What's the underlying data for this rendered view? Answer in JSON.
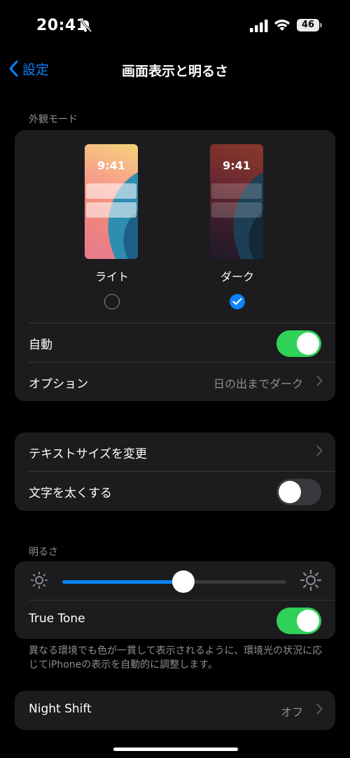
{
  "status_bar": {
    "time": "20:41",
    "battery": "46"
  },
  "nav": {
    "back_label": "設定",
    "title": "画面表示と明るさ"
  },
  "appearance": {
    "section_header": "外観モード",
    "light": {
      "label": "ライト",
      "preview_time": "9:41",
      "selected": false
    },
    "dark": {
      "label": "ダーク",
      "preview_time": "9:41",
      "selected": true
    },
    "auto": {
      "label": "自動",
      "on": true
    },
    "options": {
      "label": "オプション",
      "value": "日の出までダーク"
    }
  },
  "text": {
    "text_size": {
      "label": "テキストサイズを変更"
    },
    "bold_text": {
      "label": "文字を太くする",
      "on": false
    }
  },
  "brightness": {
    "section_header": "明るさ",
    "level": 0.54,
    "true_tone": {
      "label": "True Tone",
      "on": true
    },
    "footer": "異なる環境でも色が一貫して表示されるように、環境光の状況に応じてiPhoneの表示を自動的に調整します。"
  },
  "night_shift": {
    "label": "Night Shift",
    "value": "オフ"
  },
  "colors": {
    "accent": "#0a84ff",
    "toggle_on": "#30d158",
    "group_bg": "#1c1c1e"
  }
}
